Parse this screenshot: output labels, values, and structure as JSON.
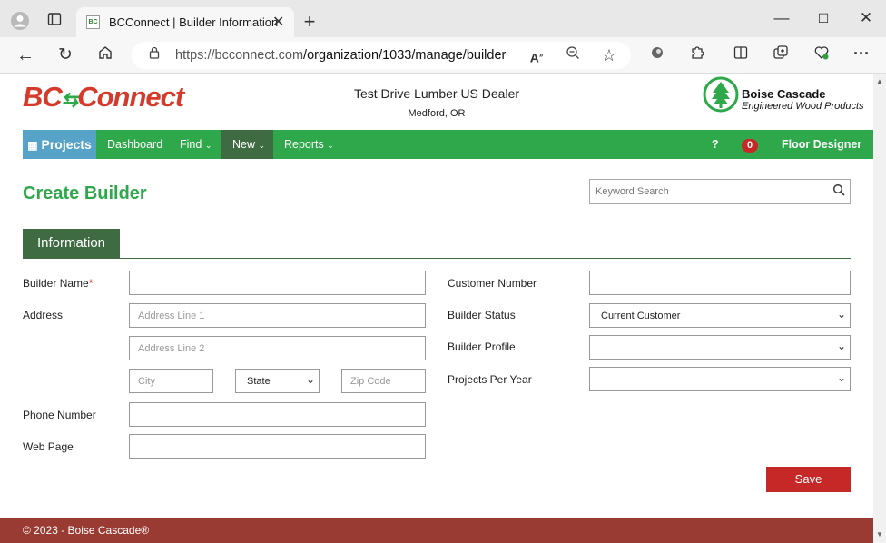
{
  "browser": {
    "tab_title": "BCConnect | Builder Information",
    "favicon_text": "BC",
    "url_host": "https://bcconnect.com",
    "url_path": "/organization/1033/manage/builder"
  },
  "header": {
    "logo_a": "BC",
    "logo_b": "Connect",
    "dealer_name": "Test Drive Lumber US Dealer",
    "dealer_location": "Medford, OR",
    "brand_name": "Boise Cascade",
    "brand_tagline": "Engineered Wood Products"
  },
  "nav": {
    "projects": "Projects",
    "dashboard": "Dashboard",
    "find": "Find",
    "new": "New",
    "reports": "Reports",
    "help": "?",
    "notifications": "0",
    "floor_designer": "Floor Designer"
  },
  "main": {
    "title": "Create Builder",
    "search_placeholder": "Keyword Search",
    "tab": "Information"
  },
  "form": {
    "builder_name_label": "Builder Name",
    "required_mark": "*",
    "address_label": "Address",
    "address1_placeholder": "Address Line 1",
    "address2_placeholder": "Address Line 2",
    "city_placeholder": "City",
    "state_value": "State",
    "zip_placeholder": "Zip Code",
    "phone_label": "Phone Number",
    "web_label": "Web Page",
    "customer_number_label": "Customer Number",
    "builder_status_label": "Builder Status",
    "builder_status_value": "Current Customer",
    "builder_profile_label": "Builder Profile",
    "projects_per_year_label": "Projects Per Year",
    "save_label": "Save"
  },
  "footer": {
    "copyright": "© 2023 - Boise Cascade®"
  },
  "colors": {
    "brand_green": "#2ea84a",
    "dark_green": "#3f6b42",
    "projects_blue": "#57a3c7",
    "brand_red": "#c62828",
    "footer_red": "#9a3b33"
  }
}
